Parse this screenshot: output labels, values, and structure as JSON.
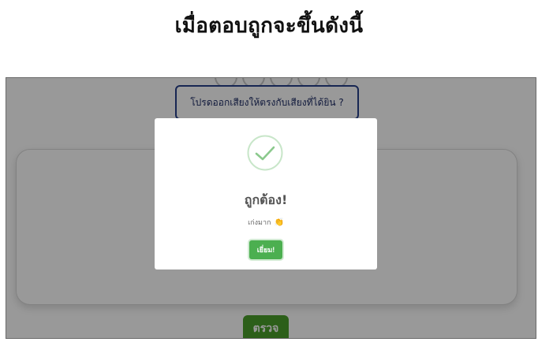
{
  "heading": "เมื่อตอบถูกจะขึ้นดังนี้",
  "quiz": {
    "prompt": "โปรดออกเสียงให้ตรงกับเสียงที่ได้ยิน ?",
    "check_label": "ตรวจ"
  },
  "modal": {
    "icon": "check-circle-icon",
    "title": "ถูกต้อง!",
    "message": "เก่งมาก",
    "emoji": "👏",
    "confirm_label": "เยี่ยม!"
  },
  "colors": {
    "accent_green": "#4caf50",
    "check_button": "#4a9e2a",
    "prompt_border": "#27408b"
  }
}
